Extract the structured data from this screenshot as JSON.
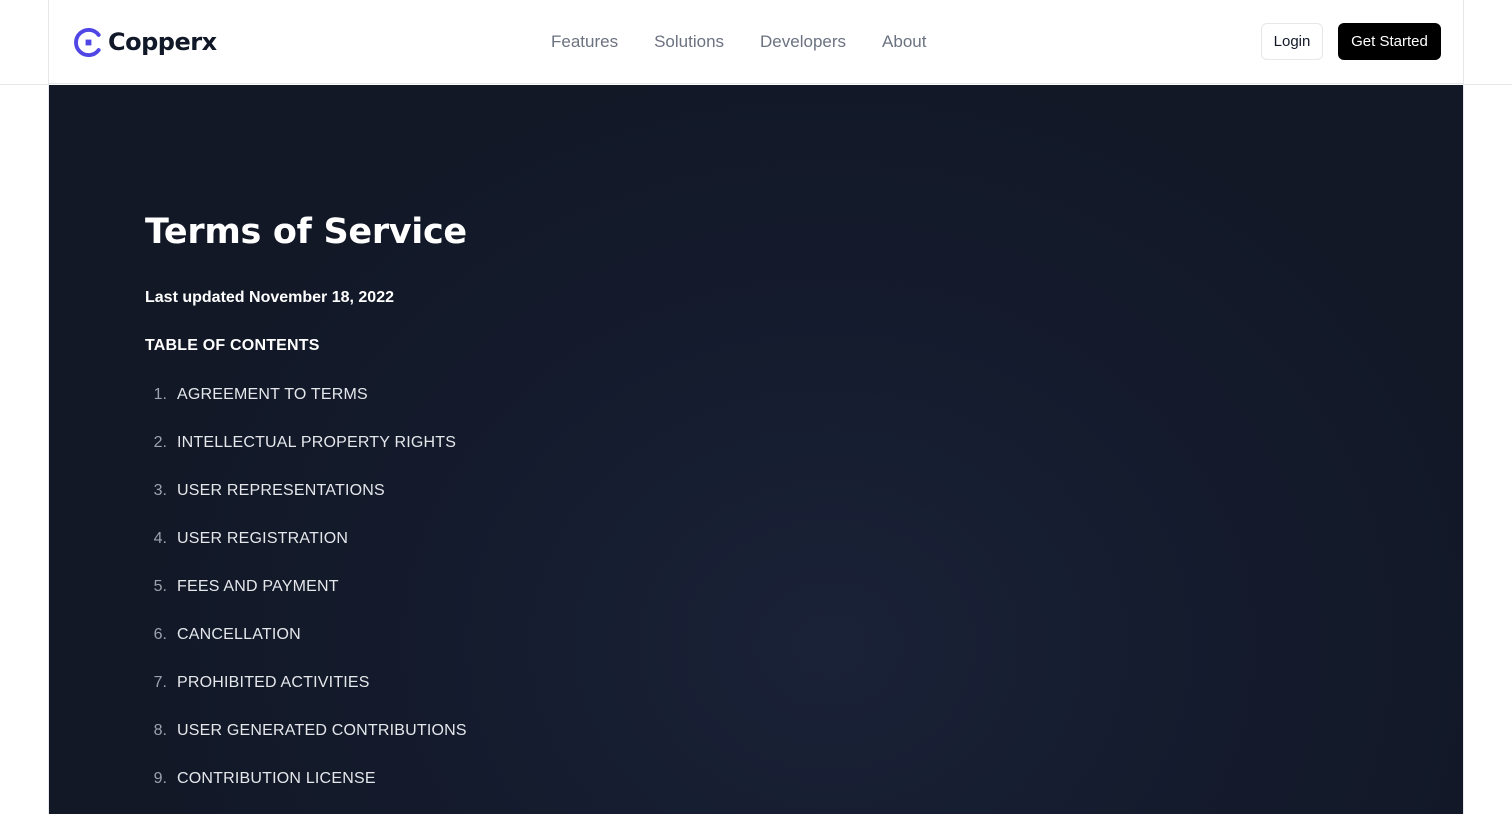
{
  "brand": {
    "name": "Copperx",
    "logo_color": "#4f46e5"
  },
  "nav": {
    "items": [
      {
        "label": "Features"
      },
      {
        "label": "Solutions"
      },
      {
        "label": "Developers"
      },
      {
        "label": "About"
      }
    ]
  },
  "header": {
    "login_label": "Login",
    "get_started_label": "Get Started"
  },
  "main": {
    "title": "Terms of Service",
    "last_updated": "Last updated November 18, 2022",
    "toc_heading": "TABLE OF CONTENTS",
    "toc": [
      {
        "num": "1.",
        "label": "AGREEMENT TO TERMS"
      },
      {
        "num": "2.",
        "label": "INTELLECTUAL PROPERTY RIGHTS"
      },
      {
        "num": "3.",
        "label": "USER REPRESENTATIONS"
      },
      {
        "num": "4.",
        "label": "USER REGISTRATION"
      },
      {
        "num": "5.",
        "label": "FEES AND PAYMENT"
      },
      {
        "num": "6.",
        "label": "CANCELLATION"
      },
      {
        "num": "7.",
        "label": "PROHIBITED ACTIVITIES"
      },
      {
        "num": "8.",
        "label": "USER GENERATED CONTRIBUTIONS"
      },
      {
        "num": "9.",
        "label": "CONTRIBUTION LICENSE"
      }
    ]
  }
}
